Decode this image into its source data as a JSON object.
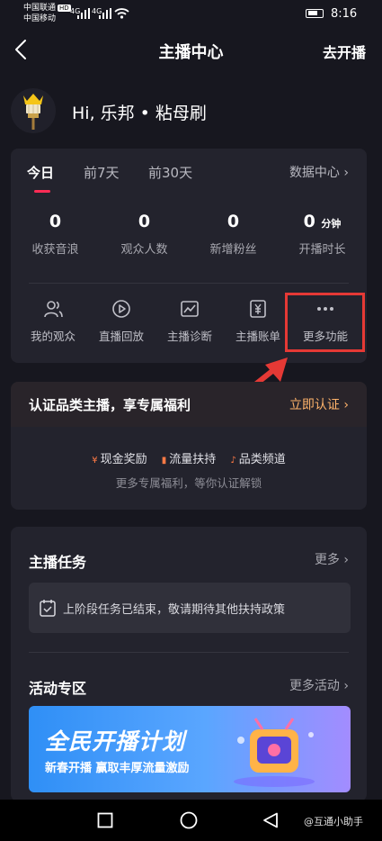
{
  "status_bar": {
    "carrier1": "中国联通",
    "carrier1_badge": "HD",
    "carrier2": "中国移动",
    "signal1": "4G",
    "signal2": "4G",
    "time": "8:16"
  },
  "nav": {
    "title": "主播中心",
    "action": "去开播"
  },
  "profile": {
    "greeting": "Hi, 乐邦 • 粘母刷"
  },
  "data_card": {
    "tabs": [
      "今日",
      "前7天",
      "前30天"
    ],
    "data_center": "数据中心",
    "stats": [
      {
        "value": "0",
        "unit": "",
        "label": "收获音浪"
      },
      {
        "value": "0",
        "unit": "",
        "label": "观众人数"
      },
      {
        "value": "0",
        "unit": "",
        "label": "新增粉丝"
      },
      {
        "value": "0",
        "unit": "分钟",
        "label": "开播时长"
      }
    ],
    "functions": [
      {
        "label": "我的观众",
        "icon": "audience-icon"
      },
      {
        "label": "直播回放",
        "icon": "replay-icon"
      },
      {
        "label": "主播诊断",
        "icon": "diagnosis-icon"
      },
      {
        "label": "主播账单",
        "icon": "bill-icon"
      },
      {
        "label": "更多功能",
        "icon": "more-icon"
      }
    ]
  },
  "certification": {
    "title": "认证品类主播，享专属福利",
    "action": "立即认证",
    "perks": [
      "现金奖励",
      "流量扶持",
      "品类频道"
    ],
    "subtitle": "更多专属福利，等你认证解锁"
  },
  "tasks": {
    "title": "主播任务",
    "more": "更多",
    "message": "上阶段任务已结束，敬请期待其他扶持政策"
  },
  "activities": {
    "title": "活动专区",
    "more": "更多活动",
    "banner_title": "全民开播计划",
    "banner_subtitle": "新春开播 赢取丰厚流量激励"
  },
  "system_nav": {
    "watermark": "@互通小助手"
  },
  "colors": {
    "background": "#17171f",
    "card": "#23232d",
    "accent": "#fe2c55",
    "cert_action": "#ffb36b",
    "highlight": "#e53935"
  }
}
